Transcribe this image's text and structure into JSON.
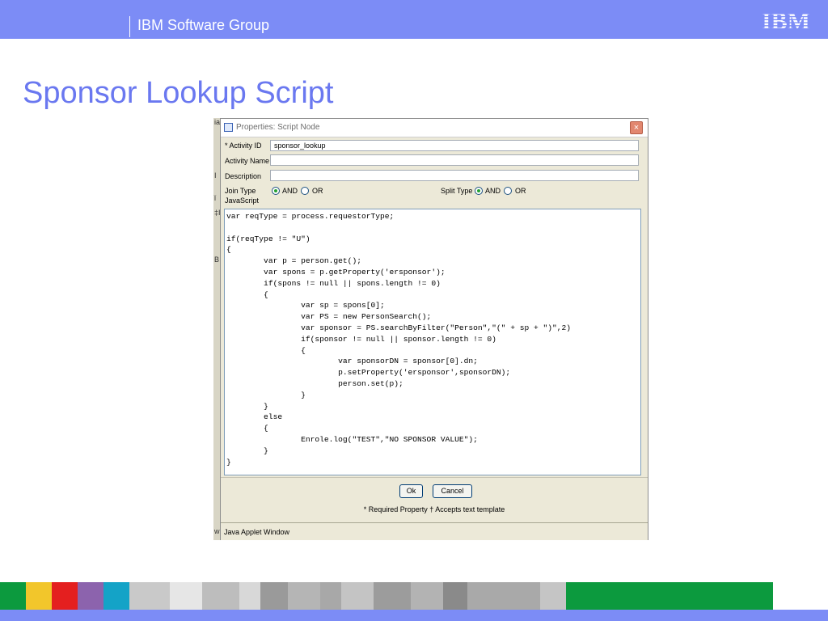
{
  "header": {
    "group": "IBM Software Group",
    "logo_text": "IBM"
  },
  "slide": {
    "title": "Sponsor Lookup Script"
  },
  "dialog": {
    "title": "Properties: Script Node",
    "close_glyph": "×",
    "fields": {
      "activity_id": {
        "label": "* Activity ID",
        "value": "sponsor_lookup"
      },
      "activity_name": {
        "label": "Activity Name",
        "value": ""
      },
      "description": {
        "label": "Description",
        "value": ""
      }
    },
    "join_type": {
      "label": "Join Type",
      "options": [
        "AND",
        "OR"
      ],
      "selected": "AND"
    },
    "split_type": {
      "label": "Split Type",
      "options": [
        "AND",
        "OR"
      ],
      "selected": "AND"
    },
    "script_label": "JavaScript",
    "script": "var reqType = process.requestorType;\n\nif(reqType != \"U\")\n{\n        var p = person.get();\n        var spons = p.getProperty('ersponsor');\n        if(spons != null || spons.length != 0)\n        {\n                var sp = spons[0];\n                var PS = new PersonSearch();\n                var sponsor = PS.searchByFilter(\"Person\",\"(\" + sp + \")\",2)\n                if(sponsor != null || sponsor.length != 0)\n                {\n                        var sponsorDN = sponsor[0].dn;\n                        p.setProperty('ersponsor',sponsorDN);\n                        person.set(p);\n                }\n        }\n        else\n        {\n                Enrole.log(\"TEST\",\"NO SPONSOR VALUE\");\n        }\n}",
    "ok_label": "Ok",
    "cancel_label": "Cancel",
    "legend": "* Required Property  † Accepts text template",
    "status": "Java Applet Window"
  },
  "background_glyphs": [
    "ia",
    "I",
    "ǐ",
    "‡I",
    "B",
    "w"
  ],
  "colors": {
    "header_bg": "#7c8cf6",
    "title": "#6a78f0",
    "stripes": [
      "#0c9a3e",
      "#f2c62b",
      "#e41f1f",
      "#8c63ad",
      "#14a3c7",
      "#c9c9c9",
      "#e6e6e6",
      "#bdbdbd",
      "#d8d8d8",
      "#9a9a9a",
      "#b5b5b5",
      "#a8a8a8",
      "#c4c4c4",
      "#9c9c9c",
      "#b3b3b3",
      "#8a8a8a",
      "#a9a9a9",
      "#c5c5c5"
    ]
  }
}
